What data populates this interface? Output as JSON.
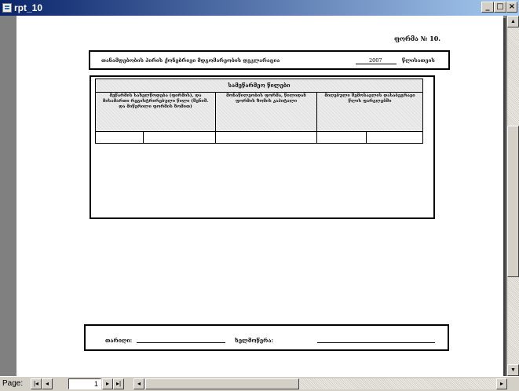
{
  "window": {
    "title": "rpt_10",
    "minimize_glyph": "_",
    "maximize_glyph": "□",
    "close_glyph": "×"
  },
  "report": {
    "form_number": "ფორმა № 10.",
    "header": {
      "organization_title": "თანამდებობის პირის ქონებრივი მდგომარეობის დეკლარაცია",
      "year": "2007",
      "year_suffix": "წლისათვის"
    },
    "table": {
      "title": "სამეწარმეო წილები",
      "columns": [
        "მეწარმის სახელწოდება (ფირმის), და მისამართი რეგისტრირებული წილი (შენიშ. და მიწერილი ფორმის ზომით)",
        "მონაწილეობის ფორმა, წილიდან ფორმის ზომის კაპიტალი",
        "მიღებული შემოსავლის დასაბეგრავი წლის ფარგლებში"
      ]
    },
    "footer": {
      "date_label": "თარიღი:",
      "signature_label": "ხელმოწერა:"
    }
  },
  "navigation": {
    "page_label": "Page:",
    "current_page": "1",
    "first_glyph": "|◂",
    "prev_glyph": "◂",
    "next_glyph": "▸",
    "last_glyph": "▸|"
  },
  "scrollbars": {
    "up_glyph": "▲",
    "down_glyph": "▼",
    "left_glyph": "◂",
    "right_glyph": "▸"
  },
  "colors": {
    "titlebar_start": "#0a246a",
    "titlebar_end": "#a6caf0",
    "workspace": "#808080",
    "chrome": "#d4d0c8"
  }
}
